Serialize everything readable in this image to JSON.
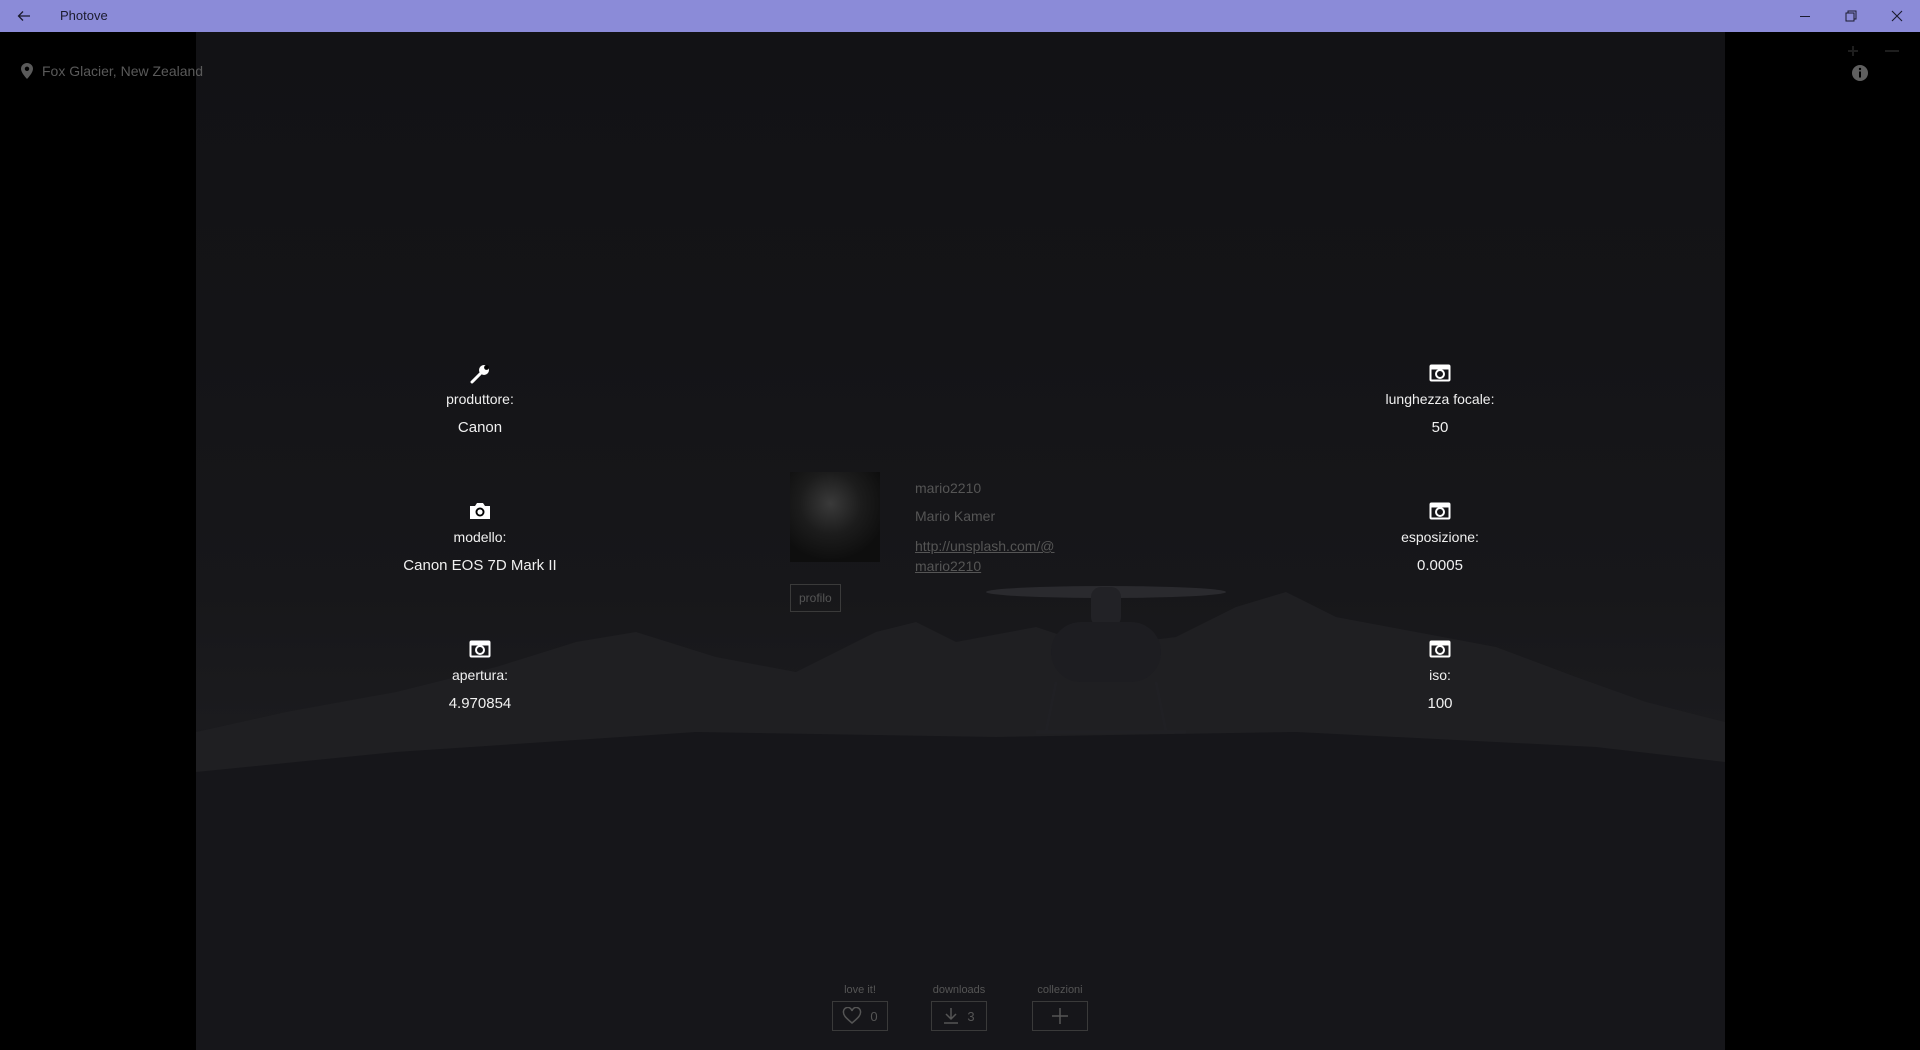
{
  "app": {
    "title": "Photove"
  },
  "location": {
    "text": "Fox Glacier, New Zealand"
  },
  "meta": {
    "manufacturer": {
      "label": "produttore:",
      "value": "Canon",
      "icon": "wrench-icon"
    },
    "model": {
      "label": "modello:",
      "value": "Canon EOS 7D Mark II",
      "icon": "camera-icon"
    },
    "aperture": {
      "label": "apertura:",
      "value": "4.970854",
      "icon": "camera-alt-icon"
    },
    "focal_length": {
      "label": "lunghezza focale:",
      "value": "50",
      "icon": "camera-alt-icon"
    },
    "exposure": {
      "label": "esposizione:",
      "value": "0.0005",
      "icon": "camera-alt-icon"
    },
    "iso": {
      "label": "iso:",
      "value": "100",
      "icon": "camera-alt-icon"
    }
  },
  "user": {
    "username": "mario2210",
    "fullname": "Mario Kamer",
    "link": "http://unsplash.com/@mario2210",
    "profile_button": "profilo"
  },
  "actions": {
    "love": {
      "label": "love it!",
      "count": "0"
    },
    "downloads": {
      "label": "downloads",
      "count": "3"
    },
    "collections": {
      "label": "collezioni"
    }
  },
  "colors": {
    "titlebar": "#8b8bd8",
    "background": "#000000",
    "dim_text": "#555555"
  }
}
